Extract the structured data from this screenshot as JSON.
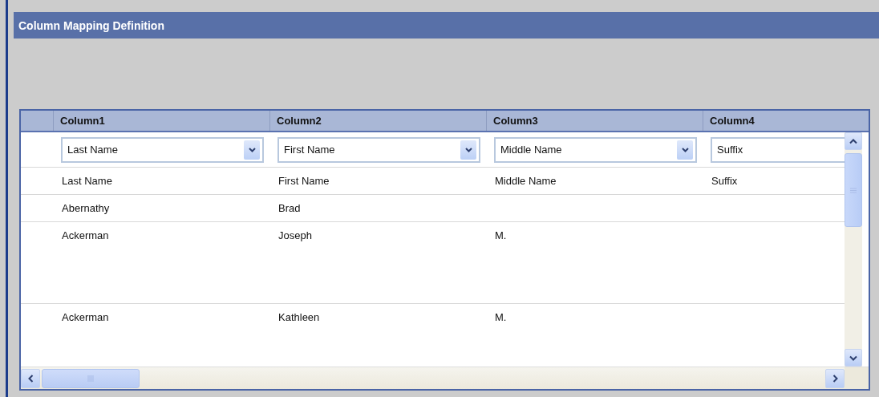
{
  "panel": {
    "title": "Column Mapping Definition"
  },
  "table": {
    "columns": [
      "Column1",
      "Column2",
      "Column3",
      "Column4"
    ],
    "mappings": [
      {
        "value": "Last Name",
        "kind": "dropdown"
      },
      {
        "value": "First Name",
        "kind": "dropdown"
      },
      {
        "value": "Middle Name",
        "kind": "dropdown"
      },
      {
        "value": "Suffix",
        "kind": "cut"
      }
    ],
    "rows": [
      [
        "Last Name",
        "First Name",
        "Middle Name",
        "Suffix"
      ],
      [
        "Abernathy",
        "Brad",
        "",
        ""
      ],
      [
        "Ackerman",
        "Joseph",
        "M.",
        ""
      ],
      [
        "Ackerman",
        "Kathleen",
        "M.",
        ""
      ]
    ]
  }
}
